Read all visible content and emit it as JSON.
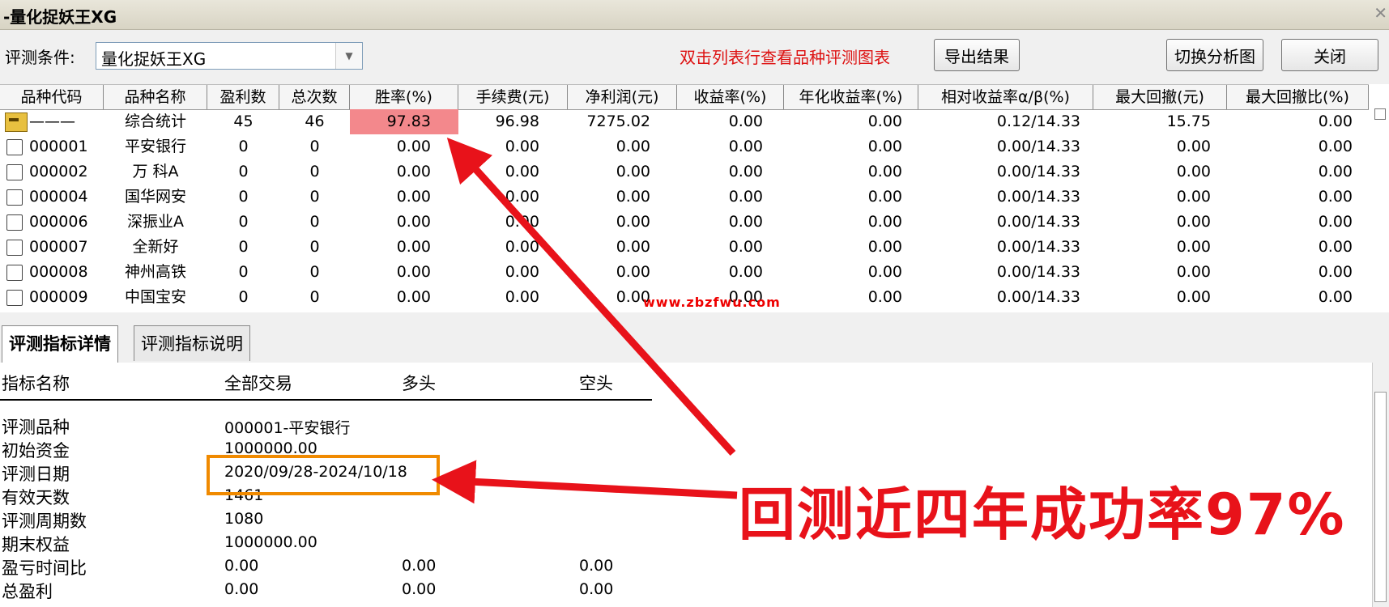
{
  "window": {
    "title": "-量化捉妖王XG"
  },
  "toolbar": {
    "condition_label": "评测条件:",
    "condition_value": "量化捉妖王XG",
    "hint": "双击列表行查看品种评测图表",
    "export_label": "导出结果",
    "switch_label": "切换分析图",
    "close_label": "关闭"
  },
  "grid": {
    "headers": [
      "品种代码",
      "品种名称",
      "盈利数",
      "总次数",
      "胜率(%)",
      "手续费(元)",
      "净利润(元)",
      "收益率(%)",
      "年化收益率(%)",
      "相对收益率α/β(%)",
      "最大回撤(元)",
      "最大回撤比(%)"
    ],
    "summary": {
      "code": "———",
      "name": "综合统计",
      "profit": "45",
      "total": "46",
      "win": "97.83",
      "fee": "96.98",
      "net": "7275.02",
      "ret": "0.00",
      "annual": "0.00",
      "ab": "0.12/14.33",
      "dd": "15.75",
      "ddr": "0.00"
    },
    "rows": [
      {
        "code": "000001",
        "name": "平安银行",
        "profit": "0",
        "total": "0",
        "win": "0.00",
        "fee": "0.00",
        "net": "0.00",
        "ret": "0.00",
        "annual": "0.00",
        "ab": "0.00/14.33",
        "dd": "0.00",
        "ddr": "0.00"
      },
      {
        "code": "000002",
        "name": "万 科A",
        "profit": "0",
        "total": "0",
        "win": "0.00",
        "fee": "0.00",
        "net": "0.00",
        "ret": "0.00",
        "annual": "0.00",
        "ab": "0.00/14.33",
        "dd": "0.00",
        "ddr": "0.00"
      },
      {
        "code": "000004",
        "name": "国华网安",
        "profit": "0",
        "total": "0",
        "win": "0.00",
        "fee": "0.00",
        "net": "0.00",
        "ret": "0.00",
        "annual": "0.00",
        "ab": "0.00/14.33",
        "dd": "0.00",
        "ddr": "0.00"
      },
      {
        "code": "000006",
        "name": "深振业A",
        "profit": "0",
        "total": "0",
        "win": "0.00",
        "fee": "0.00",
        "net": "0.00",
        "ret": "0.00",
        "annual": "0.00",
        "ab": "0.00/14.33",
        "dd": "0.00",
        "ddr": "0.00"
      },
      {
        "code": "000007",
        "name": "全新好",
        "profit": "0",
        "total": "0",
        "win": "0.00",
        "fee": "0.00",
        "net": "0.00",
        "ret": "0.00",
        "annual": "0.00",
        "ab": "0.00/14.33",
        "dd": "0.00",
        "ddr": "0.00"
      },
      {
        "code": "000008",
        "name": "神州高铁",
        "profit": "0",
        "total": "0",
        "win": "0.00",
        "fee": "0.00",
        "net": "0.00",
        "ret": "0.00",
        "annual": "0.00",
        "ab": "0.00/14.33",
        "dd": "0.00",
        "ddr": "0.00"
      },
      {
        "code": "000009",
        "name": "中国宝安",
        "profit": "0",
        "total": "0",
        "win": "0.00",
        "fee": "0.00",
        "net": "0.00",
        "ret": "0.00",
        "annual": "0.00",
        "ab": "0.00/14.33",
        "dd": "0.00",
        "ddr": "0.00"
      }
    ]
  },
  "tabs": [
    {
      "label": "评测指标详情"
    },
    {
      "label": "评测指标说明"
    }
  ],
  "detail": {
    "headers": {
      "name": "指标名称",
      "all": "全部交易",
      "long": "多头",
      "short": "空头"
    },
    "rows": [
      {
        "label": "评测品种",
        "all": "000001-平安银行"
      },
      {
        "label": "初始资金",
        "all": "1000000.00"
      },
      {
        "label": "评测日期",
        "all": "2020/09/28-2024/10/18"
      },
      {
        "label": "有效天数",
        "all": "1461"
      },
      {
        "label": "评测周期数",
        "all": "1080"
      },
      {
        "label": "期末权益",
        "all": "1000000.00"
      },
      {
        "label": "盈亏时间比",
        "all": "0.00",
        "long": "0.00",
        "short": "0.00"
      },
      {
        "label": "总盈利",
        "all": "0.00",
        "long": "0.00",
        "short": "0.00"
      }
    ]
  },
  "annotation": {
    "watermark": "www.zbzfwu.com",
    "caption": "回测近四年成功率97%",
    "arrow_color": "#e8121a",
    "box_color": "#f08a00",
    "highlight_color": "#f3888c"
  }
}
